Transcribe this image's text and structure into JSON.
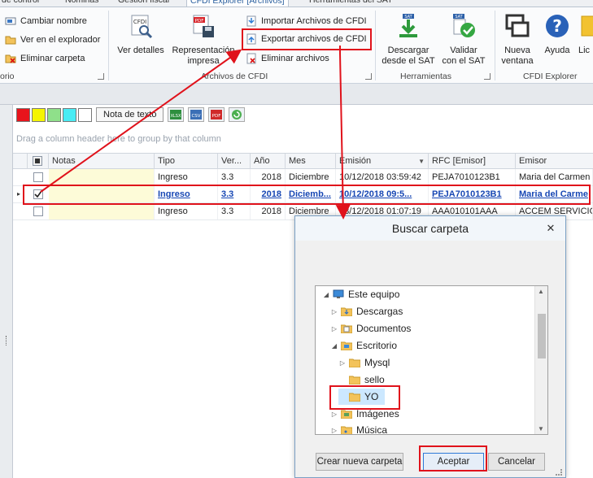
{
  "tabs": [
    {
      "label": "de control"
    },
    {
      "label": "Nominas"
    },
    {
      "label": "Gestion fiscal"
    },
    {
      "label": "CFDI Explorer [Archivos]"
    },
    {
      "label": "Herramientas del SAT"
    }
  ],
  "ribbon": {
    "group1": {
      "label": "orio",
      "buttons": [
        "Cambiar nombre",
        "Ver en el explorador",
        "Eliminar carpeta"
      ]
    },
    "group2": {
      "label": "Archivos de CFDI",
      "ver_detalles": "Ver detalles",
      "representacion_1": "Representación",
      "representacion_2": "impresa",
      "importar": "Importar Archivos de CFDI",
      "exportar": "Exportar archivos de CFDI",
      "eliminar": "Eliminar archivos",
      "cfdi_icon_text": "CFDI",
      "pdf_icon_text": "PDF"
    },
    "group3": {
      "label": "Herramientas",
      "descargar_1": "Descargar",
      "descargar_2": "desde el SAT",
      "validar_1": "Validar",
      "validar_2": "con el SAT",
      "sat_text": "SAT"
    },
    "group4": {
      "label": "CFDI Explorer",
      "nueva_1": "Nueva",
      "nueva_2": "ventana",
      "ayuda": "Ayuda",
      "lic": "Lic"
    }
  },
  "grid_toolbar": {
    "swatches": [
      "#e8141c",
      "#f5f500",
      "#8fe08a",
      "#49ecf4",
      "#ffffff"
    ],
    "note_button": "Nota de texto",
    "icons": [
      "xlsx-icon",
      "csv-icon",
      "pdf-icon",
      "refresh-icon"
    ],
    "xlsx": "XLSX",
    "csv": "CSV",
    "pdf": "PDF"
  },
  "grid": {
    "group_hint": "Drag a column header here to group by that column",
    "columns": {
      "notas": "Notas",
      "tipo": "Tipo",
      "version": "Ver...",
      "anio": "Año",
      "mes": "Mes",
      "emision": "Emisión",
      "rfc": "RFC [Emisor]",
      "emisor": "Emisor"
    },
    "rows": [
      {
        "tipo": "Ingreso",
        "version": "3.3",
        "anio": "2018",
        "mes": "Diciembre",
        "emision": "10/12/2018 03:59:42",
        "rfc": "PEJA7010123B1",
        "emisor": "Maria del Carmen Lo"
      },
      {
        "tipo": "Ingreso",
        "version": "3.3",
        "anio": "2018",
        "mes": "Diciemb...",
        "emision": "10/12/2018 09:5...",
        "rfc": "PEJA7010123B1",
        "emisor": "Maria del Carme"
      },
      {
        "tipo": "Ingreso",
        "version": "3.3",
        "anio": "2018",
        "mes": "Diciembre",
        "emision": "08/12/2018 01:07:19",
        "rfc": "AAA010101AAA",
        "emisor": "ACCEM SERVICIOS"
      }
    ]
  },
  "dialog": {
    "title": "Buscar carpeta",
    "close": "✕",
    "tree": [
      {
        "label": "Este equipo",
        "level": 0,
        "arrow": "◢",
        "icon": "computer-icon"
      },
      {
        "label": "Descargas",
        "level": 1,
        "arrow": "▷",
        "icon": "downloads-folder-icon"
      },
      {
        "label": "Documentos",
        "level": 1,
        "arrow": "▷",
        "icon": "documents-folder-icon"
      },
      {
        "label": "Escritorio",
        "level": 1,
        "arrow": "◢",
        "icon": "desktop-folder-icon"
      },
      {
        "label": "Mysql",
        "level": 2,
        "arrow": "▷",
        "icon": "folder-icon"
      },
      {
        "label": "sello",
        "level": 2,
        "arrow": "",
        "icon": "folder-icon"
      },
      {
        "label": "YO",
        "level": 2,
        "arrow": "",
        "icon": "folder-icon"
      },
      {
        "label": "Imágenes",
        "level": 1,
        "arrow": "▷",
        "icon": "pictures-folder-icon"
      },
      {
        "label": "Música",
        "level": 1,
        "arrow": "▷",
        "icon": "music-folder-icon"
      }
    ],
    "buttons": {
      "new_folder": "Crear nueva carpeta",
      "accept": "Aceptar",
      "cancel": "Cancelar"
    }
  },
  "colors": {
    "annotation_red": "#e0121b",
    "selected_text": "#1747b4",
    "notes_bg": "#fdfbd8"
  }
}
